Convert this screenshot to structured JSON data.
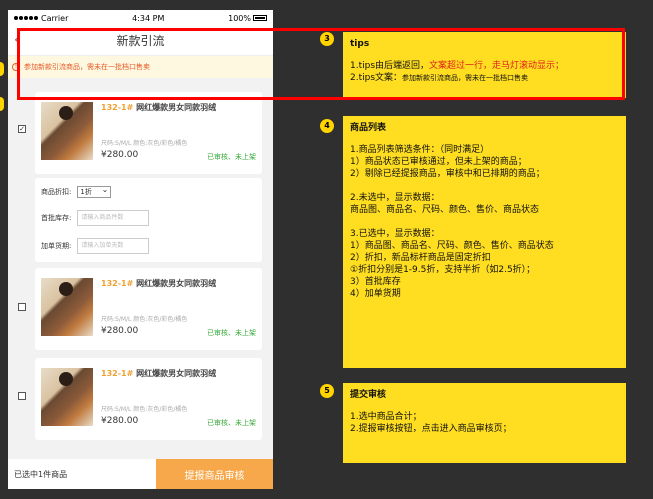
{
  "status_bar": {
    "carrier": "Carrier",
    "time": "4:34 PM",
    "battery": "100%"
  },
  "nav": {
    "title": "新款引流",
    "back": "‹"
  },
  "notice": {
    "text": "参加新款引流商品，需未在一批档口售卖"
  },
  "products": [
    {
      "code": "132-1#",
      "name": "网红爆款男女同款羽绒",
      "attrs": "尺码:S/M/L  颜色:灰色/彩色/橘色",
      "price": "¥280.00",
      "status": "已审核、未上架",
      "checked": true
    },
    {
      "code": "132-1#",
      "name": "网红爆款男女同款羽绒",
      "attrs": "尺码:S/M/L  颜色:灰色/彩色/橘色",
      "price": "¥280.00",
      "status": "已审核、未上架",
      "checked": false
    },
    {
      "code": "132-1#",
      "name": "网红爆款男女同款羽绒",
      "attrs": "尺码:S/M/L  颜色:灰色/彩色/橘色",
      "price": "¥280.00",
      "status": "已审核、未上架",
      "checked": false
    }
  ],
  "form": {
    "discount_label": "商品折扣:",
    "discount_value": "1折",
    "stock_label": "首批库存:",
    "stock_placeholder": "请输入商品件数",
    "restock_label": "加单货期:",
    "restock_placeholder": "请输入加单天数"
  },
  "bottom": {
    "selected_text": "已选中1件商品",
    "submit_label": "提报商品审核"
  },
  "annotations": {
    "tips": {
      "badge": "3",
      "title": "tips",
      "line1_prefix": "1.tips由后端返回，",
      "line1_red": "文案超过一行，走马灯滚动显示；",
      "line2_prefix": "2.tips文案：",
      "line2_small": "参加新款引流商品，需未在一批档口售卖"
    },
    "list": {
      "badge": "4",
      "title": "商品列表",
      "lines": [
        "1.商品列表筛选条件：（同时满足）",
        "1）商品状态已审核通过，但未上架的商品；",
        "2）剔除已经提报商品，审核中和已排期的商品；",
        "",
        "2.未选中，显示数据：",
        "商品图、商品名、尺码、颜色、售价、商品状态",
        "",
        "3.已选中，显示数据：",
        "1）商品图、商品名、尺码、颜色、售价、商品状态",
        "2）折扣，新品标杆商品是固定折扣",
        "①折扣分别是1-9.5折，支持半折（如2.5折）；",
        "3）首批库存",
        "4）加单货期"
      ]
    },
    "submit": {
      "badge": "5",
      "title": "提交审核",
      "lines": [
        "1.选中商品合计；",
        "2.提报审核按钮，点击进入商品审核页；"
      ]
    }
  }
}
